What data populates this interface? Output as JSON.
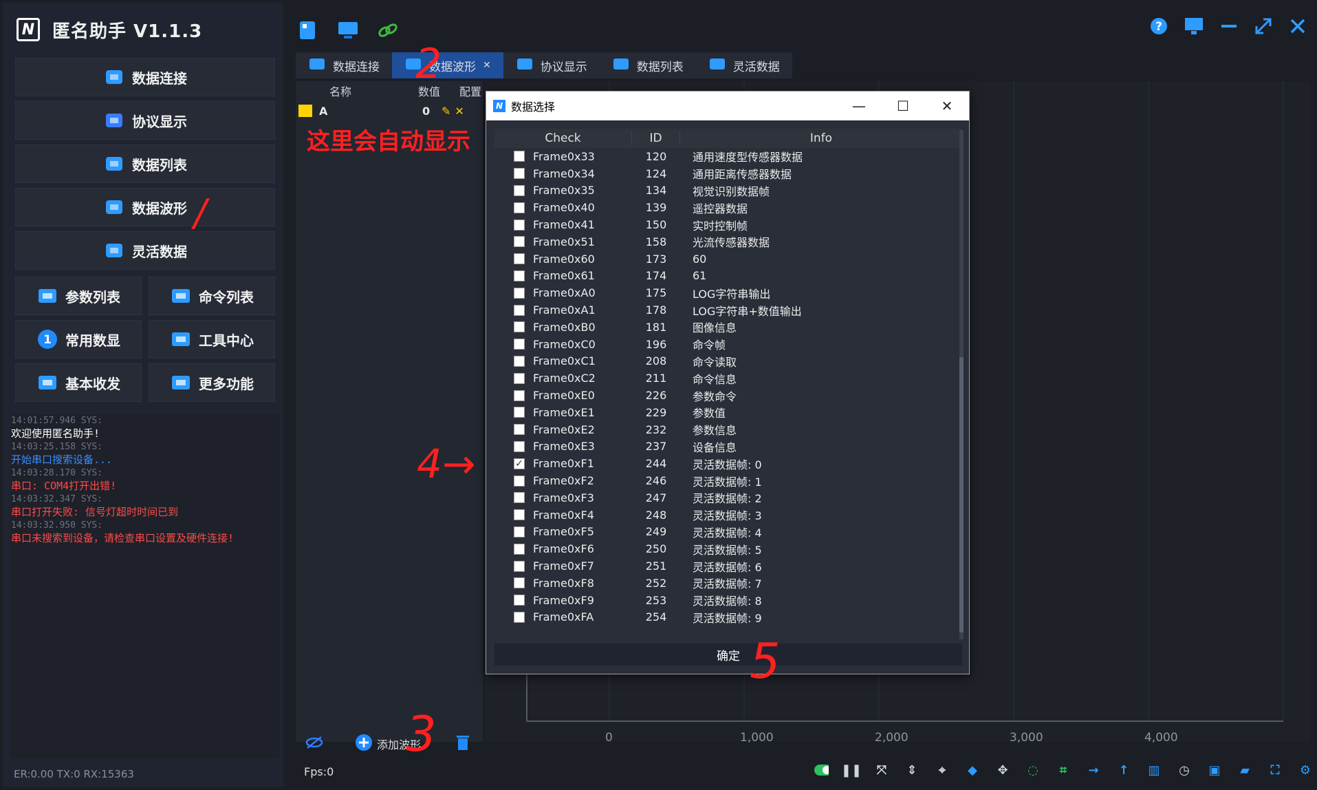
{
  "app": {
    "title": "匿名助手 V1.1.3",
    "logo_text": "N"
  },
  "sidebar": {
    "nav_large": [
      {
        "label": "数据连接",
        "icon": "link-icon"
      },
      {
        "label": "协议显示",
        "icon": "cube-icon"
      },
      {
        "label": "数据列表",
        "icon": "list-icon"
      },
      {
        "label": "数据波形",
        "icon": "waveform-icon"
      },
      {
        "label": "灵活数据",
        "icon": "blocks-icon"
      }
    ],
    "nav_small": [
      {
        "label": "参数列表",
        "icon": "sliders-icon"
      },
      {
        "label": "命令列表",
        "icon": "grid-icon"
      },
      {
        "label": "常用数显",
        "icon": "number-one-icon",
        "badge": "1"
      },
      {
        "label": "工具中心",
        "icon": "toolbox-icon"
      },
      {
        "label": "基本收发",
        "icon": "swap-arrows-icon"
      },
      {
        "label": "更多功能",
        "icon": "windows-icon"
      }
    ],
    "log": [
      {
        "ts": "14:01:57.946 SYS:",
        "msg": "欢迎使用匿名助手!",
        "color": "#ffffff"
      },
      {
        "ts": "14:03:25.158 SYS:",
        "msg": "开始串口搜索设备...",
        "color": "#3b8cff"
      },
      {
        "ts": "14:03:28.170 SYS:",
        "msg": "串口: COM4打开出错!",
        "color": "#ff4a4a"
      },
      {
        "ts": "14:03:32.347 SYS:",
        "msg": "串口打开失败: 信号灯超时时间已到",
        "color": "#ff4a4a"
      },
      {
        "ts": "14:03:32.950 SYS:",
        "msg": "串口未搜索到设备，请检查串口设置及硬件连接!",
        "color": "#ff4a4a"
      }
    ],
    "status": "ER:0.00 TX:0 RX:15363"
  },
  "tabs": [
    {
      "label": "数据连接",
      "active": false
    },
    {
      "label": "数据波形",
      "active": true
    },
    {
      "label": "协议显示",
      "active": false
    },
    {
      "label": "数据列表",
      "active": false
    },
    {
      "label": "灵活数据",
      "active": false
    }
  ],
  "wave_panel": {
    "col_name": "名称",
    "col_value": "数值",
    "col_config": "配置",
    "row_name": "A",
    "row_value": "0",
    "row_color": "#ffd400",
    "add_wave_label": "添加波形",
    "fps": "Fps:0"
  },
  "annotations": {
    "auto_show": "这里会自动显示",
    "n1": "/",
    "n2": "2",
    "n3": "3",
    "n4": "4→",
    "n5": "5"
  },
  "chart_axis": {
    "x_ticks": [
      "0",
      "1,000",
      "2,000",
      "3,000",
      "4,000"
    ]
  },
  "dialog": {
    "title": "数据选择",
    "headers": {
      "check": "Check",
      "id": "ID",
      "info": "Info"
    },
    "ok_label": "确定",
    "rows": [
      {
        "name": "Frame0x33",
        "id": "120",
        "info": "通用速度型传感器数据",
        "checked": false
      },
      {
        "name": "Frame0x34",
        "id": "124",
        "info": "通用距离传感器数据",
        "checked": false
      },
      {
        "name": "Frame0x35",
        "id": "134",
        "info": "视觉识别数据帧",
        "checked": false
      },
      {
        "name": "Frame0x40",
        "id": "139",
        "info": "遥控器数据",
        "checked": false
      },
      {
        "name": "Frame0x41",
        "id": "150",
        "info": "实时控制帧",
        "checked": false
      },
      {
        "name": "Frame0x51",
        "id": "158",
        "info": "光流传感器数据",
        "checked": false
      },
      {
        "name": "Frame0x60",
        "id": "173",
        "info": "60",
        "checked": false
      },
      {
        "name": "Frame0x61",
        "id": "174",
        "info": "61",
        "checked": false
      },
      {
        "name": "Frame0xA0",
        "id": "175",
        "info": "LOG字符串输出",
        "checked": false
      },
      {
        "name": "Frame0xA1",
        "id": "178",
        "info": "LOG字符串+数值输出",
        "checked": false
      },
      {
        "name": "Frame0xB0",
        "id": "181",
        "info": "图像信息",
        "checked": false
      },
      {
        "name": "Frame0xC0",
        "id": "196",
        "info": "命令帧",
        "checked": false
      },
      {
        "name": "Frame0xC1",
        "id": "208",
        "info": "命令读取",
        "checked": false
      },
      {
        "name": "Frame0xC2",
        "id": "211",
        "info": "命令信息",
        "checked": false
      },
      {
        "name": "Frame0xE0",
        "id": "226",
        "info": "参数命令",
        "checked": false
      },
      {
        "name": "Frame0xE1",
        "id": "229",
        "info": "参数值",
        "checked": false
      },
      {
        "name": "Frame0xE2",
        "id": "232",
        "info": "参数信息",
        "checked": false
      },
      {
        "name": "Frame0xE3",
        "id": "237",
        "info": "设备信息",
        "checked": false
      },
      {
        "name": "Frame0xF1",
        "id": "244",
        "info": "灵活数据帧: 0",
        "checked": true
      },
      {
        "name": "Frame0xF2",
        "id": "246",
        "info": "灵活数据帧: 1",
        "checked": false
      },
      {
        "name": "Frame0xF3",
        "id": "247",
        "info": "灵活数据帧: 2",
        "checked": false
      },
      {
        "name": "Frame0xF4",
        "id": "248",
        "info": "灵活数据帧: 3",
        "checked": false
      },
      {
        "name": "Frame0xF5",
        "id": "249",
        "info": "灵活数据帧: 4",
        "checked": false
      },
      {
        "name": "Frame0xF6",
        "id": "250",
        "info": "灵活数据帧: 5",
        "checked": false
      },
      {
        "name": "Frame0xF7",
        "id": "251",
        "info": "灵活数据帧: 6",
        "checked": false
      },
      {
        "name": "Frame0xF8",
        "id": "252",
        "info": "灵活数据帧: 7",
        "checked": false
      },
      {
        "name": "Frame0xF9",
        "id": "253",
        "info": "灵活数据帧: 8",
        "checked": false
      },
      {
        "name": "Frame0xFA",
        "id": "254",
        "info": "灵活数据帧: 9",
        "checked": false
      }
    ]
  },
  "colors": {
    "accent": "#1f8bff",
    "active_tab": "#1f4e9a",
    "annotation": "#ff2020"
  }
}
